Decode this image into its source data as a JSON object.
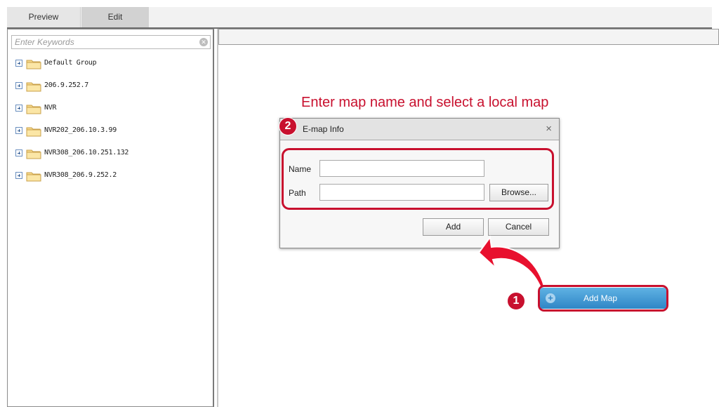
{
  "tabs": {
    "preview": "Preview",
    "edit": "Edit"
  },
  "search": {
    "placeholder": "Enter Keywords"
  },
  "tree": [
    "Default Group",
    "206.9.252.7",
    "NVR",
    "NVR202_206.10.3.99",
    "NVR308_206.10.251.132",
    "NVR308_206.9.252.2"
  ],
  "annotation": "Enter map name and select a local map",
  "dialog": {
    "title": "E-map Info",
    "close": "×",
    "step": "2",
    "name_label": "Name",
    "path_label": "Path",
    "browse": "Browse...",
    "add": "Add",
    "cancel": "Cancel"
  },
  "add_map": {
    "label": "Add Map",
    "step": "1"
  },
  "colors": {
    "annotation_red": "#c8102e",
    "button_blue": "#2f86c6"
  },
  "icons": [
    "clear-icon",
    "expand-icon",
    "folder-icon",
    "close-icon",
    "plus-icon",
    "curved-arrow-icon"
  ]
}
